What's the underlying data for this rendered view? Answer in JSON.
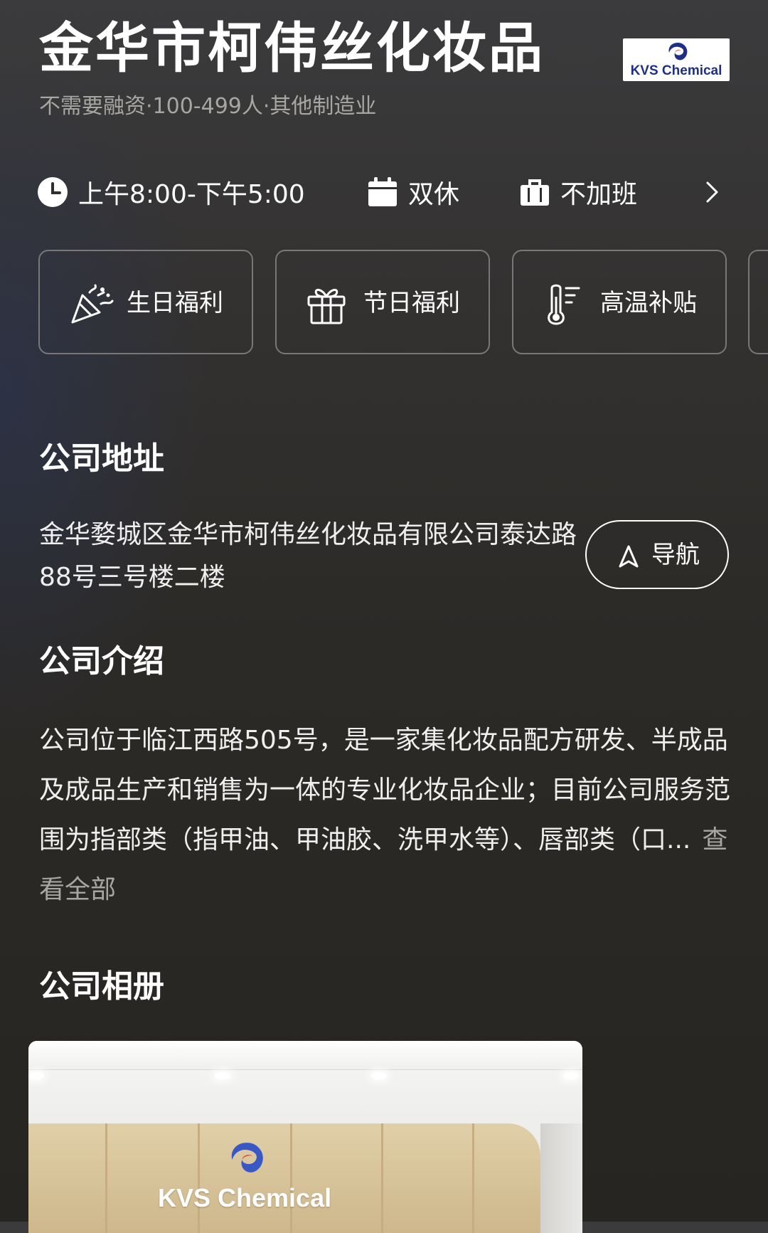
{
  "header": {
    "company_name": "金华市柯伟丝化妆品",
    "subtitle": "不需要融资·100-499人·其他制造业",
    "logo_text": "KVS Chemical"
  },
  "work_info": {
    "hours": "上午8:00-下午5:00",
    "weekend": "双休",
    "overtime": "不加班"
  },
  "benefits": [
    {
      "label": "生日福利",
      "icon": "party-popper-icon"
    },
    {
      "label": "节日福利",
      "icon": "gift-icon"
    },
    {
      "label": "高温补贴",
      "icon": "thermometer-icon"
    }
  ],
  "address": {
    "title": "公司地址",
    "text": "金华婺城区金华市柯伟丝化妆品有限公司泰达路88号三号楼二楼",
    "nav_label": "导航"
  },
  "intro": {
    "title": "公司介绍",
    "text": "公司位于临江西路505号，是一家集化妆品配方研发、半成品及成品生产和销售为一体的专业化妆品企业；目前公司服务范围为指部类（指甲油、甲油胶、洗甲水等）、唇部类（口...",
    "more_label": "查看全部"
  },
  "album": {
    "title": "公司相册",
    "photo_text": "KVS Chemical"
  },
  "colors": {
    "background": "#2c2a27",
    "muted_text": "#a8a6a2",
    "card_border": "#79767a",
    "logo_blue": "#1f2f86",
    "logo_red": "#d93a3a"
  }
}
